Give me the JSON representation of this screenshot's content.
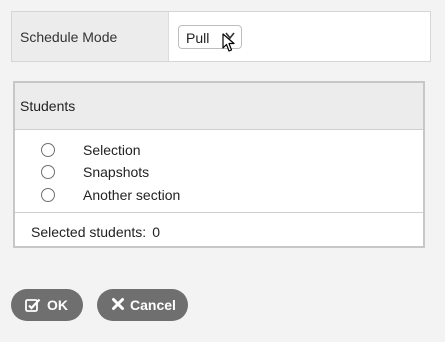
{
  "schedule_mode": {
    "label": "Schedule Mode",
    "selected_value": "Pull"
  },
  "students": {
    "title": "Students",
    "options": [
      {
        "label": "Selection",
        "checked": false
      },
      {
        "label": "Snapshots",
        "checked": false
      },
      {
        "label": "Another section",
        "checked": false
      }
    ],
    "selected_label": "Selected students:",
    "selected_count": "0"
  },
  "buttons": {
    "ok": {
      "label": "OK",
      "icon": "checkbox-edit-icon"
    },
    "cancel": {
      "label": "Cancel",
      "icon": "close-icon"
    }
  },
  "colors": {
    "button_bg": "#6f6f6f",
    "panel_header_bg": "#ececec",
    "page_bg": "#f3f3f3"
  }
}
